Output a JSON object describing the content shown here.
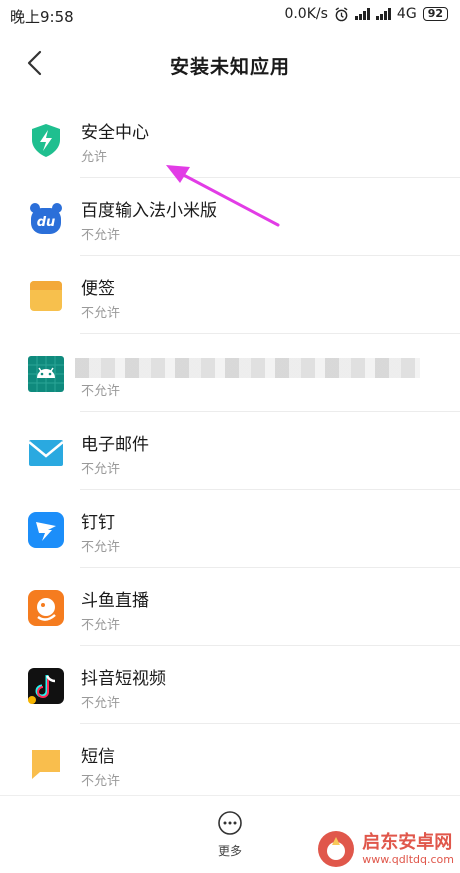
{
  "status_bar": {
    "time": "晚上9:58",
    "speed": "0.0K/s",
    "network": "4G",
    "battery": "92"
  },
  "header": {
    "title": "安装未知应用"
  },
  "apps": [
    {
      "name": "安全中心",
      "status": "允许",
      "icon": "shield-icon"
    },
    {
      "name": "百度输入法小米版",
      "status": "不允许",
      "icon": "baidu-input-icon"
    },
    {
      "name": "便签",
      "status": "不允许",
      "icon": "notes-icon"
    },
    {
      "name": "",
      "status": "不允许",
      "icon": "android-icon"
    },
    {
      "name": "电子邮件",
      "status": "不允许",
      "icon": "email-icon"
    },
    {
      "name": "钉钉",
      "status": "不允许",
      "icon": "dingtalk-icon"
    },
    {
      "name": "斗鱼直播",
      "status": "不允许",
      "icon": "douyu-icon"
    },
    {
      "name": "抖音短视频",
      "status": "不允许",
      "icon": "tiktok-icon"
    },
    {
      "name": "短信",
      "status": "不允许",
      "icon": "message-icon"
    }
  ],
  "bottom": {
    "more_label": "更多"
  },
  "watermark": {
    "title": "启东安卓网",
    "url": "www.qdltdq.com"
  },
  "colors": {
    "annotation_arrow": "#e23ce6",
    "shield": "#1fbf8f",
    "email": "#2aa9e0",
    "notes": "#f7c04d"
  }
}
